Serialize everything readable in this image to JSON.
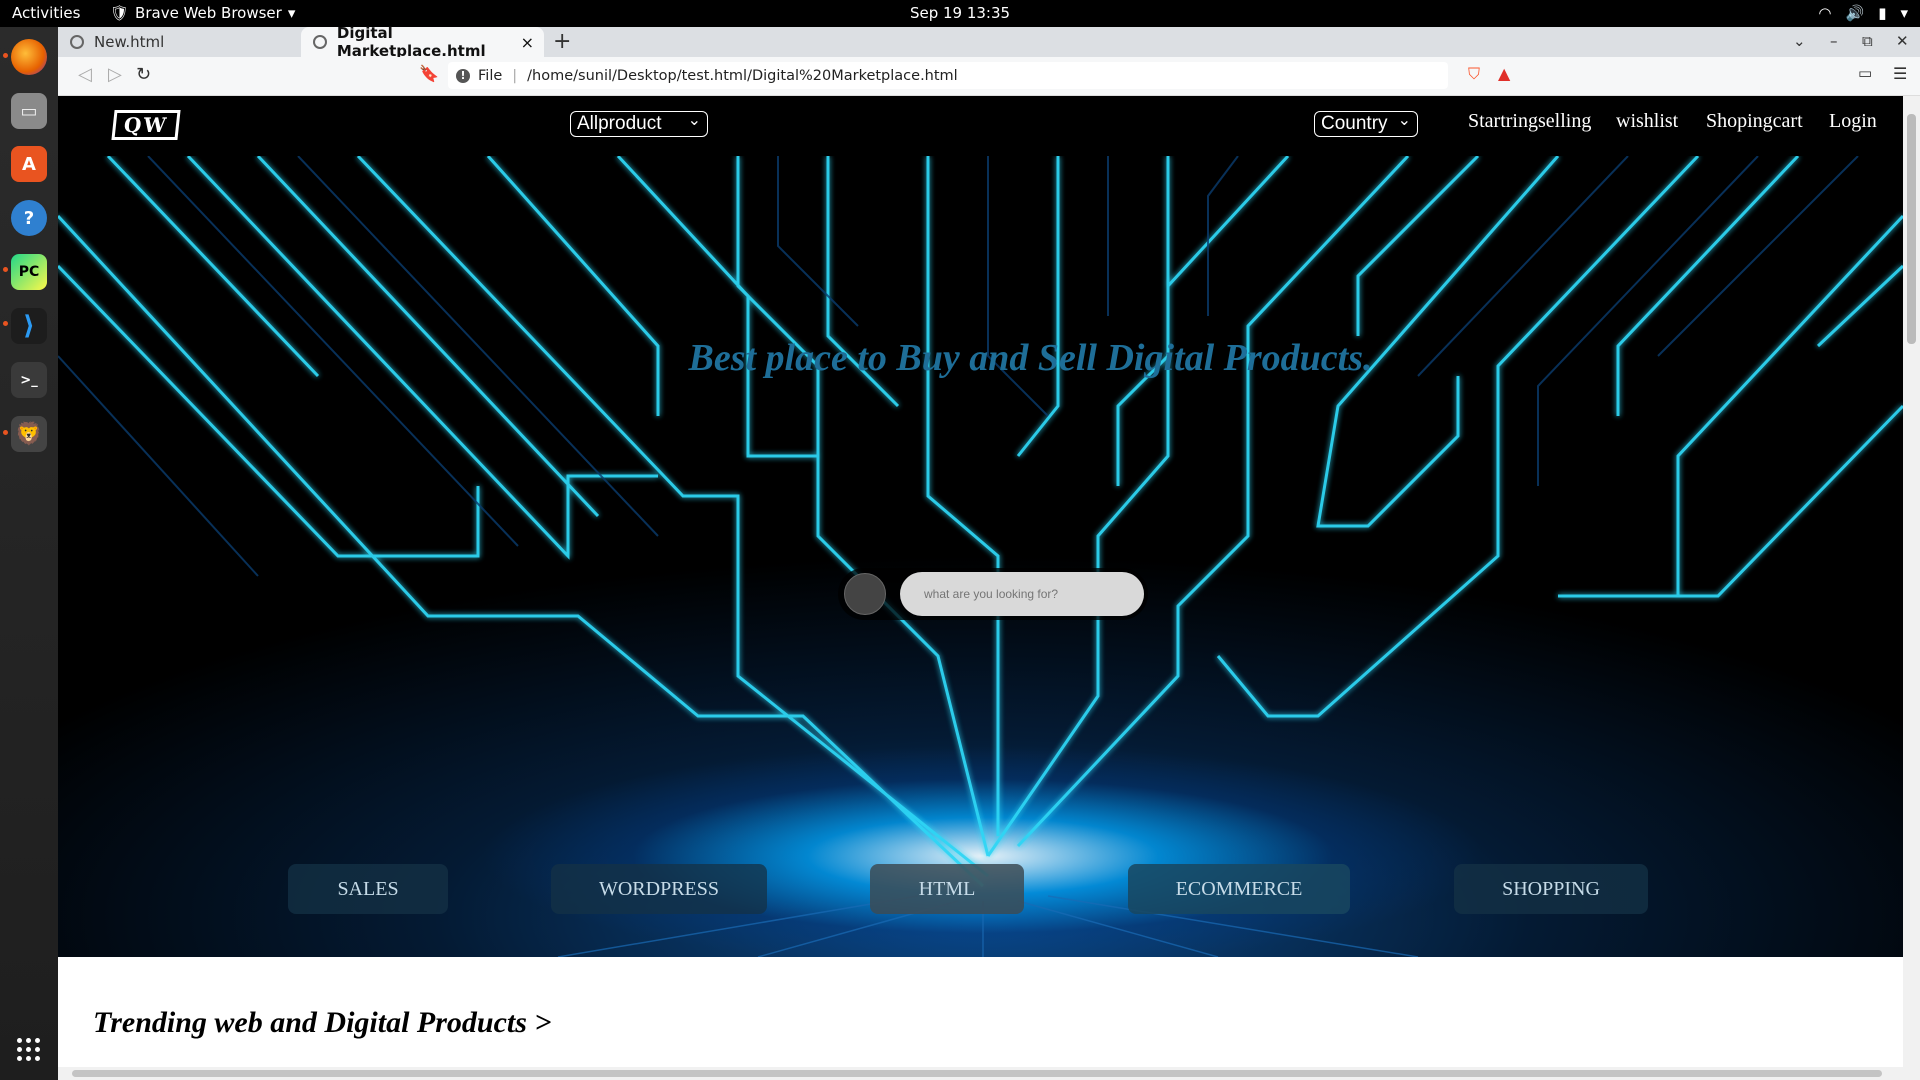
{
  "system": {
    "activities": "Activities",
    "app_menu": "Brave Web Browser",
    "clock": "Sep 19  13:35"
  },
  "dock": {
    "apps": [
      "firefox-icon",
      "files-icon",
      "app-center-icon",
      "help-icon",
      "pycharm-icon",
      "vscode-icon",
      "terminal-icon",
      "brave-icon"
    ]
  },
  "browser": {
    "tabs": [
      {
        "title": "New.html",
        "active": false
      },
      {
        "title": "Digital Marketplace.html",
        "active": true
      }
    ],
    "new_tab": "+",
    "url_scheme": "File",
    "url": "/home/sunil/Desktop/test.html/Digital%20Marketplace.html"
  },
  "site": {
    "logo": "QW",
    "product_select": "Allproduct",
    "country_select": "Country",
    "nav_links": [
      "Startringselling",
      "wishlist",
      "Shopingcart",
      "Login"
    ],
    "hero_title": "Best place to Buy and Sell Digital Products.",
    "search_placeholder": "what are you looking for?",
    "categories": [
      "SALES",
      "WORDPRESS",
      "HTML",
      "ECOMMERCE",
      "SHOPPING"
    ],
    "trending_heading": "Trending web and Digital Products >"
  },
  "colors": {
    "neon": "#2fd6f5",
    "hero_title": "#1e6e98",
    "nav_bg": "#000000"
  }
}
